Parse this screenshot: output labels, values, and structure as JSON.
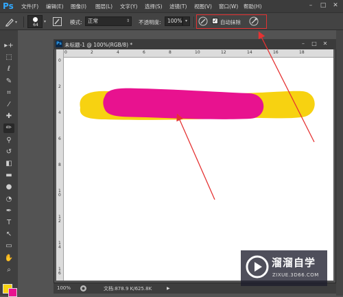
{
  "app": {
    "logo": "Ps"
  },
  "menu": [
    "文件(F)",
    "编辑(E)",
    "图像(I)",
    "图层(L)",
    "文字(Y)",
    "选择(S)",
    "滤镜(T)",
    "视图(V)",
    "窗口(W)",
    "帮助(H)"
  ],
  "window_controls": {
    "minimize": "–",
    "maximize": "□",
    "close": "✕"
  },
  "options": {
    "brush_size": "64",
    "mode_label": "模式:",
    "mode_value": "正常",
    "opacity_label": "不透明度:",
    "opacity_value": "100%",
    "auto_erase_label": "自动抹除",
    "auto_erase_checked": true
  },
  "tools": [
    {
      "name": "move-tool",
      "glyph": "▸+"
    },
    {
      "name": "marquee-tool",
      "glyph": "⬚"
    },
    {
      "name": "lasso-tool",
      "glyph": "ℓ"
    },
    {
      "name": "quick-select-tool",
      "glyph": "✎"
    },
    {
      "name": "crop-tool",
      "glyph": "⌗"
    },
    {
      "name": "eyedropper-tool",
      "glyph": "⁄"
    },
    {
      "name": "healing-tool",
      "glyph": "✚"
    },
    {
      "name": "pencil-tool",
      "glyph": "✏"
    },
    {
      "name": "clone-stamp-tool",
      "glyph": "⚲"
    },
    {
      "name": "history-brush-tool",
      "glyph": "↺"
    },
    {
      "name": "eraser-tool",
      "glyph": "◧"
    },
    {
      "name": "gradient-tool",
      "glyph": "▬"
    },
    {
      "name": "blur-tool",
      "glyph": "●"
    },
    {
      "name": "dodge-tool",
      "glyph": "◔"
    },
    {
      "name": "pen-tool",
      "glyph": "✒"
    },
    {
      "name": "type-tool",
      "glyph": "T"
    },
    {
      "name": "path-select-tool",
      "glyph": "↖"
    },
    {
      "name": "shape-tool",
      "glyph": "▭"
    },
    {
      "name": "hand-tool",
      "glyph": "✋"
    },
    {
      "name": "zoom-tool",
      "glyph": "⌕"
    }
  ],
  "colors": {
    "foreground": "#f7d211",
    "background": "#e8128f",
    "stroke_yellow": "#f7d211",
    "stroke_pink": "#e8128f"
  },
  "document": {
    "title": "未标题-1 @ 100%(RGB/8) *",
    "ruler_top": [
      "0",
      "2",
      "4",
      "6",
      "8",
      "10",
      "12",
      "14",
      "16",
      "18"
    ],
    "ruler_left": [
      "0",
      "2",
      "4",
      "6",
      "8",
      "1\n0",
      "1\n2",
      "1\n4",
      "1\n6"
    ]
  },
  "status": {
    "zoom": "100%",
    "doc_size": "文档:878.9 K/625.8K"
  },
  "watermark": {
    "name": "溜溜自学",
    "url": "ZIXUE.3D66.COM"
  }
}
